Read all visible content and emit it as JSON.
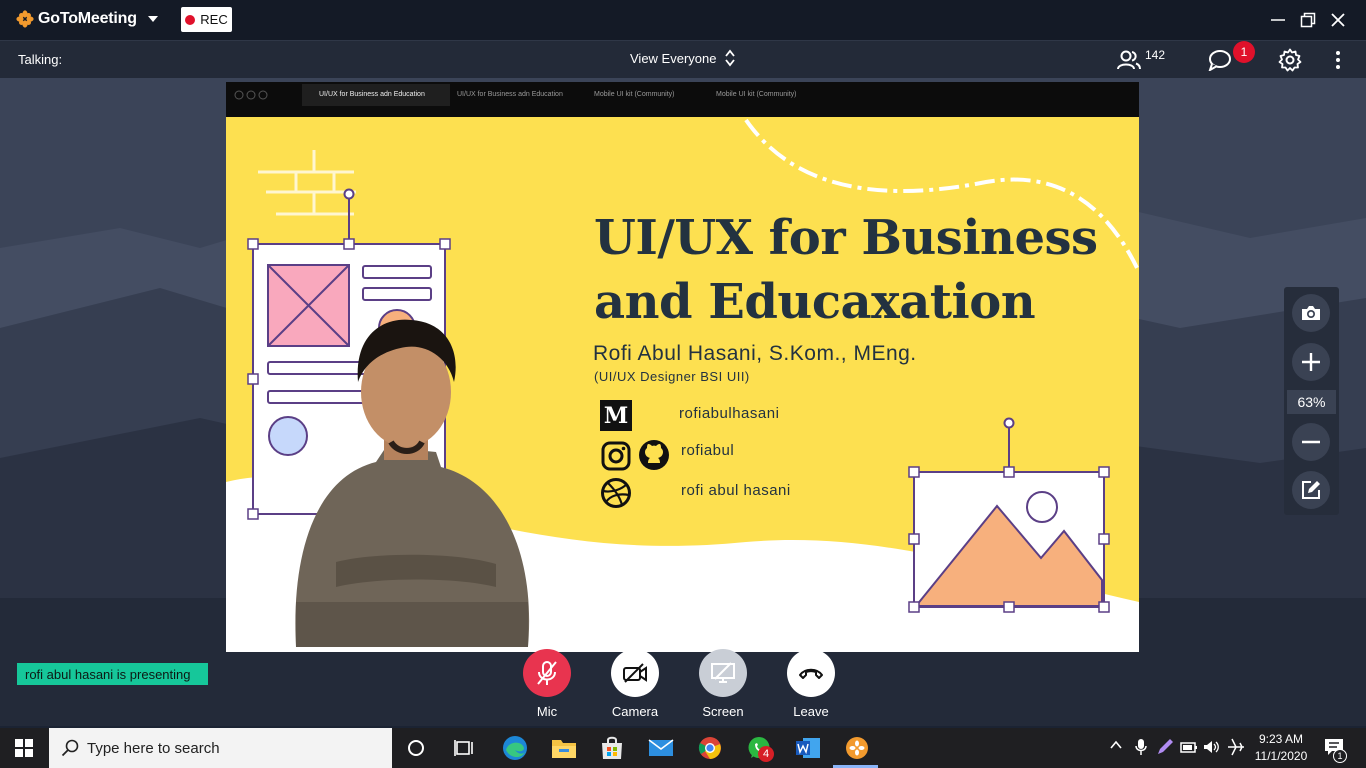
{
  "app": {
    "name": "GoToMeeting",
    "rec_label": "REC"
  },
  "toolbar": {
    "talking_label": "Talking:",
    "view_label": "View Everyone",
    "attendee_count": "142",
    "chat_badge": "1"
  },
  "slide": {
    "tabs": [
      "UI/UX for Business adn Education",
      "UI/UX for Business adn Education",
      "Mobile UI kit (Community)",
      "Mobile UI kit (Community)"
    ],
    "title_line1": "UI/UX for Business",
    "title_line2": "and Educaxation",
    "presenter_name": "Rofi Abul Hasani, S.Kom., MEng.",
    "presenter_role": "(UI/UX Designer BSI UII)",
    "medium_handle": "rofiabulhasani",
    "instagram_github_handle": "rofiabul",
    "dribbble_handle": "rofi abul hasani",
    "medium_glyph": "M"
  },
  "zoom": {
    "level": "63%"
  },
  "status": {
    "presenting": "rofi abul hasani is presenting"
  },
  "controls": {
    "mic": "Mic",
    "camera": "Camera",
    "screen": "Screen",
    "leave": "Leave"
  },
  "taskbar": {
    "search_placeholder": "Type here to search",
    "whatsapp_badge": "4",
    "time": "9:23 AM",
    "date": "11/1/2020",
    "notification_count": "1"
  },
  "colors": {
    "slide_bg": "#fde050",
    "accent_orange": "#f29a2e",
    "mic_red": "#e8344f",
    "presenting_green": "#16c79a",
    "title_dark": "#233240"
  }
}
